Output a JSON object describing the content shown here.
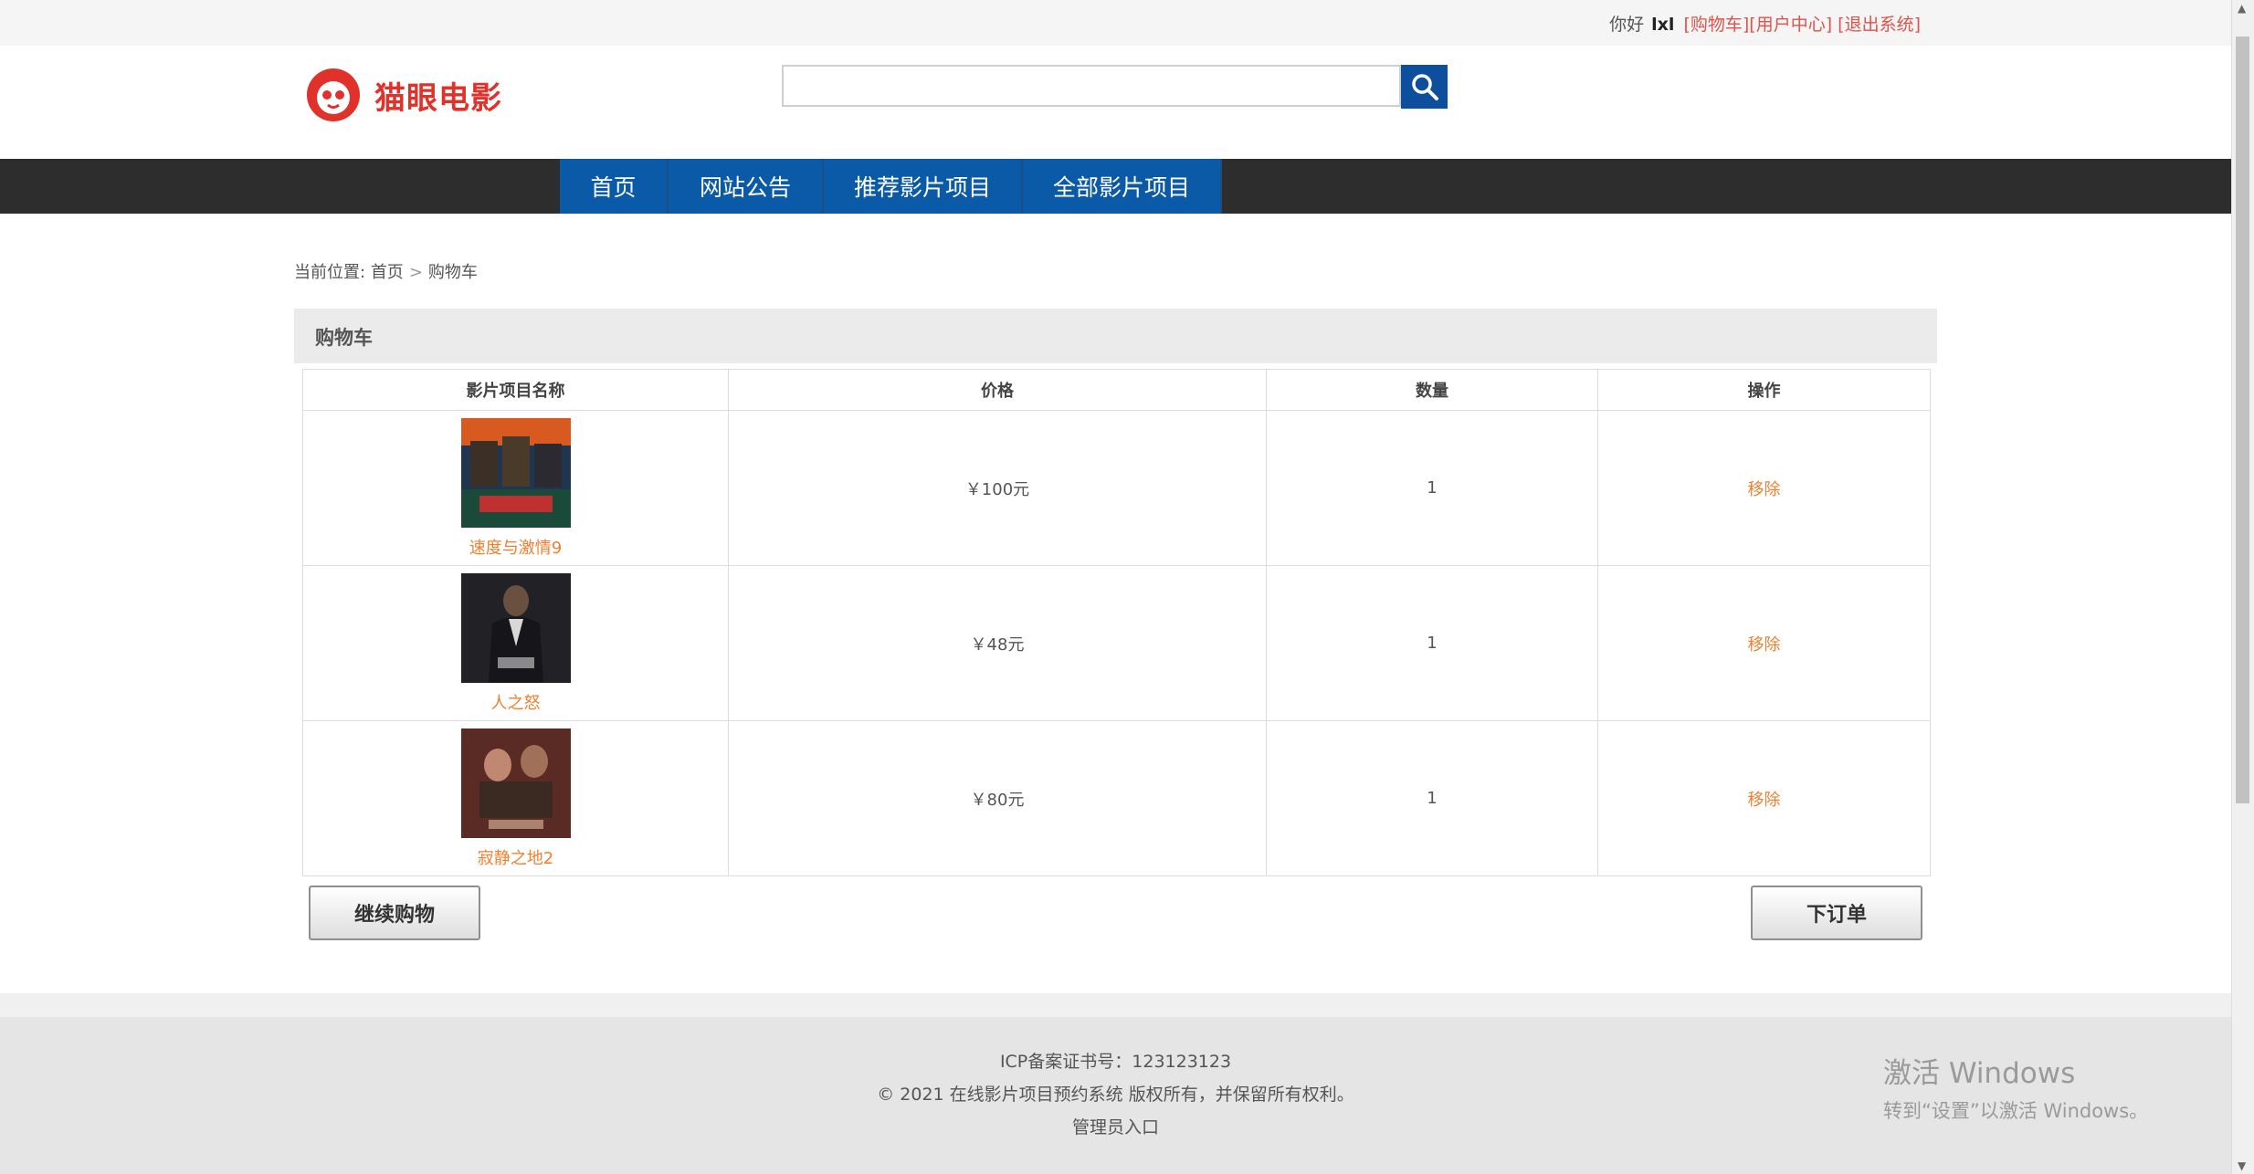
{
  "topbar": {
    "greeting": "你好",
    "username": "lxl",
    "cart_link": "[购物车]",
    "user_center_link": "[用户中心]",
    "logout_link": "[退出系统]"
  },
  "header": {
    "logo_text": "猫眼电影",
    "search": {
      "value": "",
      "placeholder": ""
    }
  },
  "nav": {
    "items": [
      "首页",
      "网站公告",
      "推荐影片项目",
      "全部影片项目"
    ]
  },
  "breadcrumb": {
    "prefix": "当前位置:",
    "home": "首页",
    "current": "购物车"
  },
  "cart": {
    "title": "购物车",
    "columns": [
      "影片项目名称",
      "价格",
      "数量",
      "操作"
    ],
    "rows": [
      {
        "name": "速度与激情9",
        "price": "￥100元",
        "qty": "1",
        "action": "移除"
      },
      {
        "name": "人之怒",
        "price": "￥48元",
        "qty": "1",
        "action": "移除"
      },
      {
        "name": "寂静之地2",
        "price": "￥80元",
        "qty": "1",
        "action": "移除"
      }
    ],
    "continue_label": "继续购物",
    "order_label": "下订单"
  },
  "footer": {
    "icp": "ICP备案证书号：123123123",
    "copyright": "© 2021 在线影片项目预约系统 版权所有，并保留所有权利。",
    "admin_link": "管理员入口"
  },
  "watermark": {
    "line1": "激活 Windows",
    "line2": "转到“设置”以激活 Windows。"
  }
}
